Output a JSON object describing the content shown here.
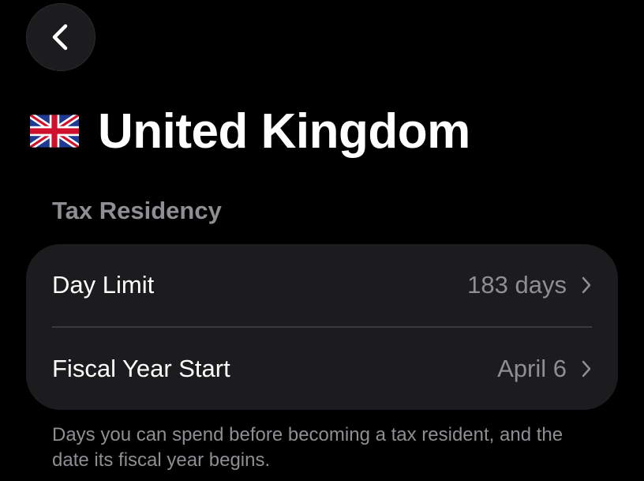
{
  "nav": {
    "back_icon": "chevron-left-icon"
  },
  "header": {
    "flag_icon": "uk-flag-icon",
    "title": "United Kingdom"
  },
  "section": {
    "title": "Tax Residency",
    "rows": [
      {
        "label": "Day Limit",
        "value": "183 days"
      },
      {
        "label": "Fiscal Year Start",
        "value": "April 6"
      }
    ],
    "footer": "Days you can spend before becoming a tax resident, and the date its fiscal year begins."
  },
  "colors": {
    "background": "#000000",
    "card": "#1c1c1e",
    "secondary_text": "#8e8e93",
    "divider": "#3a3a3c"
  }
}
